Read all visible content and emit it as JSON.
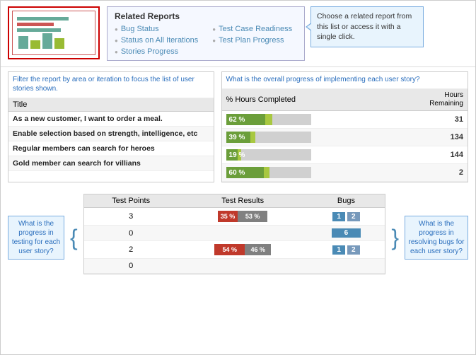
{
  "relatedReports": {
    "title": "Related Reports",
    "items": [
      {
        "label": "Bug Status"
      },
      {
        "label": "Status on All Iterations"
      },
      {
        "label": "Stories Progress"
      },
      {
        "label": "Test Case Readiness"
      },
      {
        "label": "Test Plan Progress"
      }
    ],
    "callout": "Choose a related report from this list or access it with a single click."
  },
  "filterNote": "Filter the report by area or iteration to focus the list of user stories shown.",
  "progressNote": "What is the overall progress of implementing each user story?",
  "stories": {
    "columns": [
      "Title"
    ],
    "progressColumns": [
      "% Hours Completed",
      "Hours\nRemaining"
    ],
    "rows": [
      {
        "title": "As a new customer, I want to order a meal.",
        "pct": 62,
        "pctLabel": "62 %",
        "greenWidth": 55,
        "limeWidth": 10,
        "hoursRemaining": "31"
      },
      {
        "title": "Enable selection based on strength, intelligence, etc",
        "pct": 39,
        "pctLabel": "39 %",
        "greenWidth": 34,
        "limeWidth": 7,
        "hoursRemaining": "134"
      },
      {
        "title": "Regular members can search for heroes",
        "pct": 19,
        "pctLabel": "19 %",
        "greenWidth": 16,
        "limeWidth": 5,
        "hoursRemaining": "144"
      },
      {
        "title": "Gold member can search for villians",
        "pct": 60,
        "pctLabel": "60 %",
        "greenWidth": 53,
        "limeWidth": 8,
        "hoursRemaining": "2"
      }
    ]
  },
  "testingNote": "What is the progress in testing for each user story?",
  "bugsNote": "What is the progress in resolving bugs for each user story?",
  "bottomTable": {
    "columns": [
      "Test Points",
      "Test Results",
      "Bugs"
    ],
    "rows": [
      {
        "points": "3",
        "redPct": "35 %",
        "redWidth": 35,
        "grayPct": "53 %",
        "grayWidth": 53,
        "bug1": "1",
        "bug2": "2"
      },
      {
        "points": "0",
        "redPct": "",
        "redWidth": 0,
        "grayPct": "",
        "grayWidth": 0,
        "bug1": "",
        "bug2": "6",
        "bug2wide": true
      },
      {
        "points": "2",
        "redPct": "54 %",
        "redWidth": 54,
        "grayPct": "46 %",
        "grayWidth": 46,
        "bug1": "1",
        "bug2": "2"
      },
      {
        "points": "0",
        "redPct": "",
        "redWidth": 0,
        "grayPct": "",
        "grayWidth": 0,
        "bug1": "",
        "bug2": ""
      }
    ]
  }
}
